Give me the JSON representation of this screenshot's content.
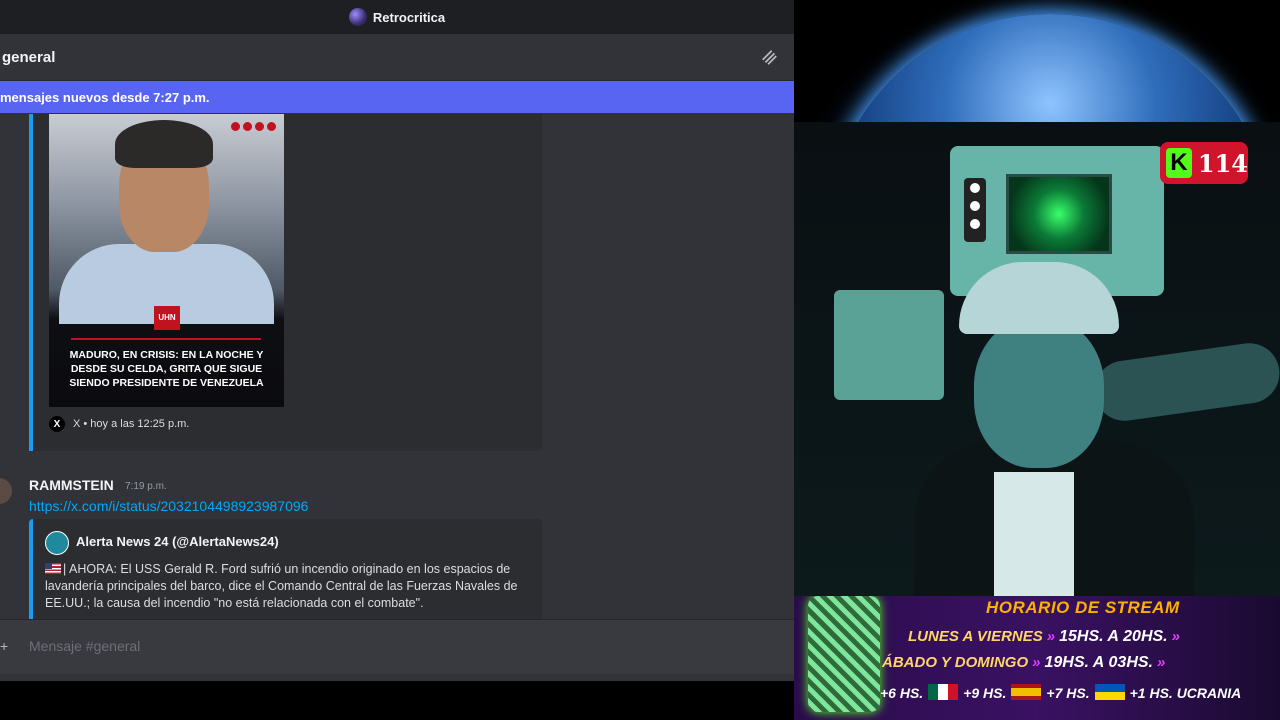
{
  "window": {
    "server_name": "Retrocritica"
  },
  "channel": {
    "name": "general"
  },
  "new_messages_bar": "mensajes nuevos desde 7:27 p.m.",
  "embed1": {
    "headline": "MADURO, EN CRISIS: EN LA NOCHE Y DESDE SU CELDA, GRITA QUE SIGUE SIENDO PRESIDENTE DE VENEZUELA",
    "brand": "UHN",
    "footer": "X • hoy a las 12:25 p.m."
  },
  "message2": {
    "author": "RAMMSTEIN",
    "time": "7:19 p.m.",
    "link": "https://x.com/i/status/2032104498923987096",
    "embed": {
      "author": "Alerta News 24 (@AlertaNews24)",
      "text": "| AHORA: El USS Gerald R. Ford sufrió un incendio originado en los espacios de lavandería principales del barco, dice el Comando Central de las Fuerzas Navales de EE.UU.; la causa del incendio \"no está relacionada con el combate\"."
    }
  },
  "composer": {
    "placeholder": "Mensaje #general"
  },
  "stream": {
    "kick_viewers": "114",
    "schedule_title": "HORARIO DE STREAM",
    "row1": {
      "day": "LUNES A VIERNES",
      "start": "15HS. A",
      "end": "20HS."
    },
    "row2": {
      "day": "ÁBADO Y DOMINGO",
      "start": "19HS. A",
      "end": "03HS."
    },
    "tz": {
      "a": "+6 HS.",
      "b": "+9 HS.",
      "c": "+7 HS.",
      "d": "+1 HS. UCRANIA"
    }
  },
  "colors": {
    "accent": "#5865f2",
    "link": "#00a8fc",
    "embed_border": "#1d9bf0",
    "kick_green": "#53fc18"
  }
}
